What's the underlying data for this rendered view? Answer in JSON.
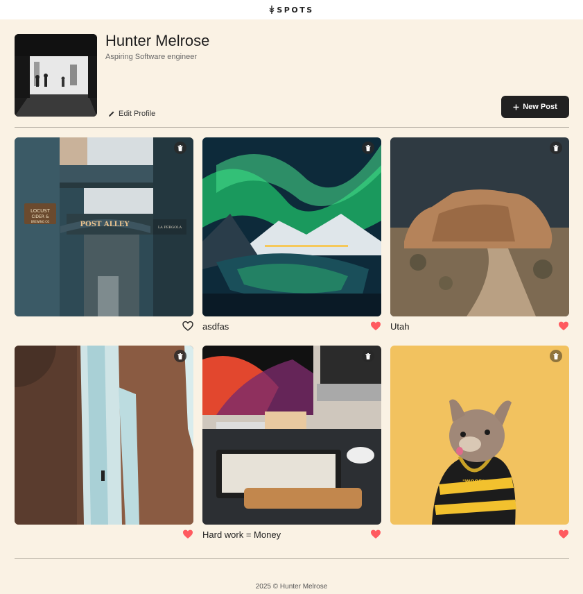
{
  "header": {
    "logo_text": "SPOTS"
  },
  "profile": {
    "name": "Hunter Melrose",
    "bio": "Aspiring Software engineer",
    "edit_label": "Edit Profile",
    "new_post_label": "New Post"
  },
  "cards": [
    {
      "caption": "",
      "liked": false
    },
    {
      "caption": "asdfas",
      "liked": true
    },
    {
      "caption": "Utah",
      "liked": true
    },
    {
      "caption": "",
      "liked": true
    },
    {
      "caption": "Hard work = Money",
      "liked": true
    },
    {
      "caption": "",
      "liked": true
    }
  ],
  "photo_signs": {
    "locust": "LOCUST",
    "cider": "CIDER &",
    "brewing": "BREWING CO",
    "post_alley": "POST ALLEY",
    "pergola": "LA PERGOLA",
    "woof": "\"WOOF\""
  },
  "colors": {
    "like": "#ff5a5f",
    "accent": "#212121",
    "background": "#faf2e4"
  },
  "footer": {
    "text": "2025 © Hunter Melrose"
  }
}
